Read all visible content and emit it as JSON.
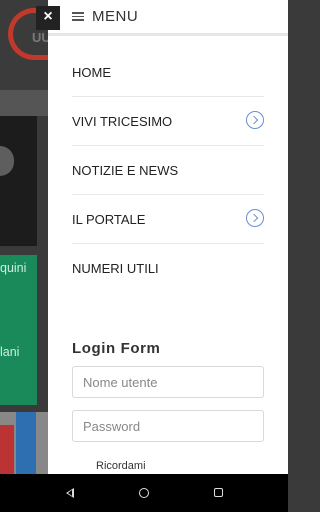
{
  "header": {
    "close_symbol": "×",
    "menu_title": "MENU"
  },
  "nav_items": [
    {
      "label": "HOME",
      "has_submenu": false
    },
    {
      "label": "VIVI TRICESIMO",
      "has_submenu": true
    },
    {
      "label": "NOTIZIE E NEWS",
      "has_submenu": false
    },
    {
      "label": "IL PORTALE",
      "has_submenu": true
    },
    {
      "label": "NUMERI UTILI",
      "has_submenu": false
    }
  ],
  "login": {
    "title": "Login Form",
    "username_placeholder": "Nome utente",
    "password_placeholder": "Password",
    "remember_label": "Ricordami"
  },
  "background": {
    "logo_text": "UU",
    "green_text_1": "quini",
    "green_text_2": "lani"
  },
  "colors": {
    "accent": "#6a8fd0",
    "brand_red": "#c0392b",
    "green": "#1a8a5a"
  }
}
